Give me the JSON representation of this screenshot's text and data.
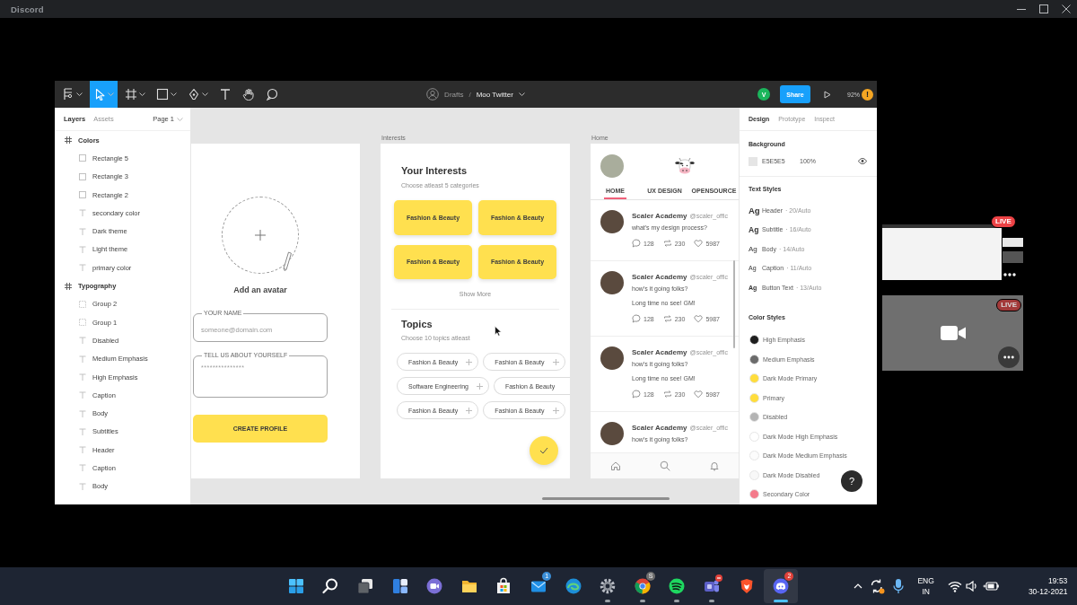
{
  "app_window": {
    "title": "Discord"
  },
  "toolbar": {
    "tools": [
      {
        "kind": "main-menu",
        "selected": false
      },
      {
        "kind": "move",
        "selected": true
      },
      {
        "kind": "frame",
        "selected": false
      },
      {
        "kind": "shape",
        "selected": false
      },
      {
        "kind": "pen",
        "selected": false
      },
      {
        "kind": "text",
        "selected": false
      },
      {
        "kind": "hand",
        "selected": false
      },
      {
        "kind": "comment",
        "selected": false
      }
    ],
    "folder": "Drafts",
    "separator": "/",
    "file": "Moo Twitter",
    "user_initial": "V",
    "share": "Share",
    "zoom": "92%",
    "warning": "!"
  },
  "layers_panel": {
    "tabs": [
      {
        "label": "Layers",
        "selected": true
      },
      {
        "label": "Assets",
        "selected": false
      }
    ],
    "page": "Page 1",
    "layers": [
      {
        "name": "Colors",
        "kind": "frame",
        "children": [
          {
            "name": "Rectangle 5",
            "kind": "rectangle"
          },
          {
            "name": "Rectangle 3",
            "kind": "rectangle"
          },
          {
            "name": "Rectangle 2",
            "kind": "rectangle"
          },
          {
            "name": "secondary color",
            "kind": "text"
          },
          {
            "name": "Dark theme",
            "kind": "text"
          },
          {
            "name": "Light theme",
            "kind": "text"
          },
          {
            "name": "primary color",
            "kind": "text"
          }
        ]
      },
      {
        "name": "Typography",
        "kind": "frame",
        "children": [
          {
            "name": "Group 2",
            "kind": "group"
          },
          {
            "name": "Group 1",
            "kind": "group"
          },
          {
            "name": "Disabled",
            "kind": "text"
          },
          {
            "name": "Medium Emphasis",
            "kind": "text"
          },
          {
            "name": "High Emphasis",
            "kind": "text"
          },
          {
            "name": "Caption",
            "kind": "text"
          },
          {
            "name": "Body",
            "kind": "text"
          },
          {
            "name": "Subtitles",
            "kind": "text"
          },
          {
            "name": "Header",
            "kind": "text"
          },
          {
            "name": "Caption",
            "kind": "text"
          },
          {
            "name": "Body",
            "kind": "text"
          }
        ]
      }
    ]
  },
  "profile_frame": {
    "avatar_caption": "Add an avatar",
    "fields": [
      {
        "kind": "single-line",
        "label": "YOUR NAME",
        "placeholder": "someone@domain.com"
      },
      {
        "kind": "multi-line",
        "label": "TELL US ABOUT YOURSELF",
        "placeholder": "***************"
      }
    ],
    "button": "CREATE PROFILE"
  },
  "interests_frame": {
    "label": "Interests",
    "title": "Your Interests",
    "subtitle": "Choose atleast 5 categories",
    "categories": [
      "Fashion & Beauty",
      "Fashion & Beauty",
      "Fashion & Beauty",
      "Fashion & Beauty"
    ],
    "show_more": "Show More",
    "topics_title": "Topics",
    "topics_subtitle": "Choose 10 topics atleast",
    "topic_rows": [
      {
        "chips": [
          {
            "kind": "full",
            "label": "Fashion & Beauty"
          },
          {
            "kind": "full",
            "label": "Fashion & Beauty"
          }
        ]
      },
      {
        "chips": [
          {
            "kind": "full",
            "label": "Software Engineering"
          },
          {
            "kind": "clipped",
            "label": "Fashion & Beauty"
          }
        ]
      },
      {
        "chips": [
          {
            "kind": "full",
            "label": "Fashion & Beauty"
          },
          {
            "kind": "full",
            "label": "Fashion & Beauty"
          }
        ]
      }
    ]
  },
  "home_frame": {
    "label": "Home",
    "tabs": [
      {
        "label": "HOME",
        "selected": true
      },
      {
        "label": "UX DESIGN",
        "selected": false
      },
      {
        "label": "OPENSOURCE",
        "selected": false
      }
    ],
    "tweets": [
      {
        "name": "Scaler Academy",
        "handle": "@scaler_offic",
        "lines": [
          "what's my design process?"
        ],
        "comments": "128",
        "retweets": "230",
        "likes": "5987"
      },
      {
        "name": "Scaler Academy",
        "handle": "@scaler_offic",
        "lines": [
          "how's it going folks?",
          "Long time no see! GM!"
        ],
        "comments": "128",
        "retweets": "230",
        "likes": "5987"
      },
      {
        "name": "Scaler Academy",
        "handle": "@scaler_offic",
        "lines": [
          "how's it going folks?",
          "Long time no see! GM!"
        ],
        "comments": "128",
        "retweets": "230",
        "likes": "5987"
      },
      {
        "name": "Scaler Academy",
        "handle": "@scaler_offic",
        "lines": [
          "how's it going folks?"
        ]
      }
    ]
  },
  "design_panel": {
    "tabs": [
      {
        "label": "Design",
        "selected": true
      },
      {
        "label": "Prototype",
        "selected": false
      },
      {
        "label": "Inspect",
        "selected": false
      }
    ],
    "background": {
      "title": "Background",
      "color": "#e5e5e5",
      "hex": "E5E5E5",
      "opacity": "100%"
    },
    "text_styles": {
      "title": "Text Styles",
      "items": [
        {
          "kind": "header",
          "sample": "Ag",
          "name": "Header",
          "detail": "· 20/Auto"
        },
        {
          "kind": "subtitle",
          "sample": "Ag",
          "name": "Subtitle",
          "detail": "· 16/Auto"
        },
        {
          "kind": "body",
          "sample": "Ag",
          "name": "Body",
          "detail": "· 14/Auto"
        },
        {
          "kind": "caption",
          "sample": "Ag",
          "name": "Caption",
          "detail": "· 11/Auto"
        },
        {
          "kind": "button",
          "sample": "Ag",
          "name": "Button Text",
          "detail": "· 13/Auto"
        }
      ]
    },
    "color_styles": {
      "title": "Color Styles",
      "items": [
        {
          "name": "High Emphasis",
          "color": "#1e1e1e"
        },
        {
          "name": "Medium Emphasis",
          "color": "#6b6b6b"
        },
        {
          "name": "Dark Mode Primary",
          "color": "#ffdd3c"
        },
        {
          "name": "Primary",
          "color": "#ffdd3c"
        },
        {
          "name": "Disabled",
          "color": "#b4b4b4"
        },
        {
          "name": "Dark Mode High Emphasis",
          "color": "#ffffff"
        },
        {
          "name": "Dark Mode Medium Emphasis",
          "color": "#fcfcfc"
        },
        {
          "name": "Dark Mode Disabled",
          "color": "#f8f8f8"
        },
        {
          "name": "Secondary Color",
          "color": "#f47a8a"
        }
      ]
    },
    "help": "?"
  },
  "stream_tiles": [
    {
      "kind": "screen",
      "badge": "LIVE"
    },
    {
      "kind": "camera",
      "badge": "LIVE"
    }
  ],
  "taskbar": {
    "apps": [
      {
        "kind": "start",
        "running": false,
        "selected": false,
        "busy": false
      },
      {
        "kind": "search",
        "running": false,
        "selected": false,
        "busy": false
      },
      {
        "kind": "task-view",
        "running": false,
        "selected": false,
        "busy": false
      },
      {
        "kind": "widgets",
        "running": false,
        "selected": false,
        "busy": false
      },
      {
        "kind": "chat",
        "running": false,
        "selected": false,
        "busy": false
      },
      {
        "kind": "explorer",
        "running": false,
        "selected": false,
        "busy": false
      },
      {
        "kind": "store",
        "running": false,
        "selected": false,
        "busy": false
      },
      {
        "kind": "mail",
        "running": false,
        "selected": false,
        "busy": false,
        "badge": {
          "text": "1",
          "color": "#3b8fd9"
        }
      },
      {
        "kind": "edge",
        "running": false,
        "selected": false,
        "busy": false
      },
      {
        "kind": "settings",
        "running": true,
        "selected": false,
        "busy": false
      },
      {
        "kind": "chrome",
        "running": true,
        "selected": false,
        "busy": false,
        "badge": {
          "text": "S",
          "color": "#6e6e6e"
        }
      },
      {
        "kind": "spotify",
        "running": true,
        "selected": false,
        "busy": false
      },
      {
        "kind": "teams",
        "running": true,
        "selected": false,
        "busy": true
      },
      {
        "kind": "brave",
        "running": false,
        "selected": false,
        "busy": false
      },
      {
        "kind": "discord",
        "running": true,
        "selected": true,
        "busy": false,
        "badge": {
          "text": "2",
          "color": "#e0413a"
        }
      }
    ],
    "language": [
      "ENG",
      "IN"
    ],
    "time": "19:53",
    "date": "30-12-2021"
  }
}
